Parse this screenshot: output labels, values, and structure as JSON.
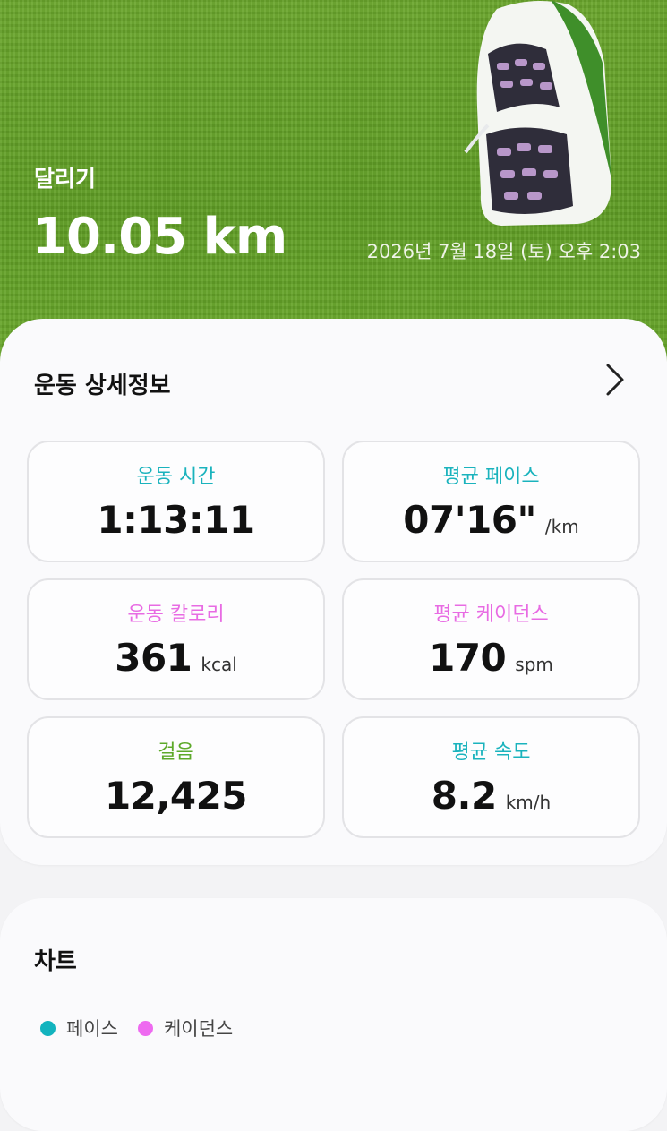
{
  "header": {
    "activity_type": "달리기",
    "distance": "10.05 km",
    "datetime": "2026년 7월 18일 (토) 오후 2:03"
  },
  "detail_card": {
    "title": "운동 상세정보",
    "stats": [
      {
        "label": "운동 시간",
        "value": "1:13:11",
        "unit": "",
        "color": "#1ab3bd"
      },
      {
        "label": "평균 페이스",
        "value": "07'16\"",
        "unit": "/km",
        "color": "#1ab3bd"
      },
      {
        "label": "운동 칼로리",
        "value": "361",
        "unit": "kcal",
        "color": "#e86be3"
      },
      {
        "label": "평균 케이던스",
        "value": "170",
        "unit": "spm",
        "color": "#e86be3"
      },
      {
        "label": "걸음",
        "value": "12,425",
        "unit": "",
        "color": "#5da92a"
      },
      {
        "label": "평균 속도",
        "value": "8.2",
        "unit": "km/h",
        "color": "#1ab3bd"
      }
    ]
  },
  "chart_card": {
    "title": "차트",
    "legend": [
      {
        "label": "페이스",
        "color": "#12b3be"
      },
      {
        "label": "케이던스",
        "color": "#ee6af0"
      }
    ]
  },
  "icons": {
    "hero_image": "running-shoe-icon",
    "more": "chevron-right-icon"
  }
}
